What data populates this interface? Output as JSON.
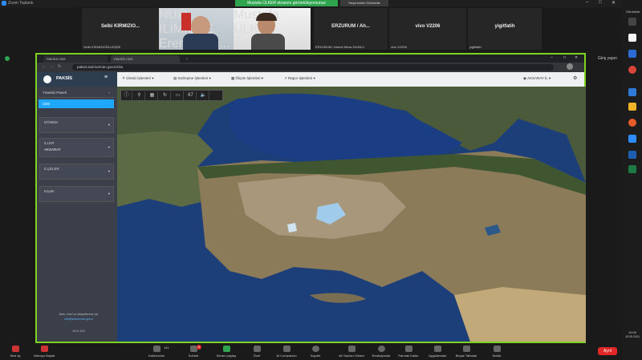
{
  "zoom": {
    "title": "Zoom Toplantı",
    "share_banner": "Mustafa ÜLKER ekranını görüntülüyorsunuz",
    "view_options": "Seçenekleri Görüntüle",
    "view_label": "Görüntüle",
    "sidebar_label": "Giriş yapın",
    "clock_time": "10:00",
    "clock_date": "15.05.2024"
  },
  "participants": [
    {
      "name": "Selbi KIRMIZIO...",
      "sub": "Selbi KIRMIZIOĞLU/İŞDE"
    },
    {
      "name": "",
      "sub": "NUR İLİMİŞDE Eren Karal..."
    },
    {
      "name": "",
      "sub": "Mustafa ÜLKER"
    },
    {
      "name": "ERZURUM / Ah...",
      "sub": "ERZURUM / Ahmet Mirac DUMLU"
    },
    {
      "name": "vivo V2206",
      "sub": "vivo V2206"
    },
    {
      "name": "yigitfatih",
      "sub": "yigitfatih"
    }
  ],
  "browser": {
    "tabs": [
      "PAKSİS CBS",
      "PAKSİS CBS"
    ],
    "url": "paksis.tarimorman.gov.tr/cbs"
  },
  "app": {
    "brand": "PAKSİS",
    "menus": [
      "Üretici İşlemleri",
      "Sözleşme İşlemleri",
      "Ölçüm İşlemleri",
      "Rapor İşlemleri"
    ],
    "user": "AKSARAY İL"
  },
  "sidebar": {
    "items": [
      "Yönetici Paneli",
      "CBS"
    ],
    "dropdowns": [
      {
        "label": "DÖNEM",
        "value": ""
      },
      {
        "label": "İLLER",
        "value": "AKSARAY"
      },
      {
        "label": "İLÇELER",
        "value": ""
      },
      {
        "label": "Köyler",
        "value": ""
      }
    ],
    "footer_text": "İstek, öneri ve şikayetleriniz için",
    "footer_link": "cbs@tarimorman.gov.tr",
    "version": "v5.0.123"
  },
  "maptools": [
    "ⓘ",
    "⚲",
    "▦",
    "↻",
    "▭",
    "67",
    "🔈"
  ],
  "toolbar": {
    "items": [
      "Sesi aç",
      "Videoyu Başlat",
      "Katılımcılar",
      "Sohbet",
      "Ekranı paylaş",
      "Özet",
      "AI Companion",
      "Kaydet",
      "Alt Yazıları Göster",
      "Reaksiyonlar",
      "Parmak Kaldır",
      "Uygulamalar",
      "Beyaz Tahtalar",
      "Notlar"
    ],
    "participants_count": "141",
    "chat_badge": "5",
    "end_label": "Ayrıl"
  },
  "colors": {
    "share_border": "#7ed321",
    "accent": "#2d8cff",
    "end": "#e02828",
    "active_item": "#1ea7fd"
  }
}
